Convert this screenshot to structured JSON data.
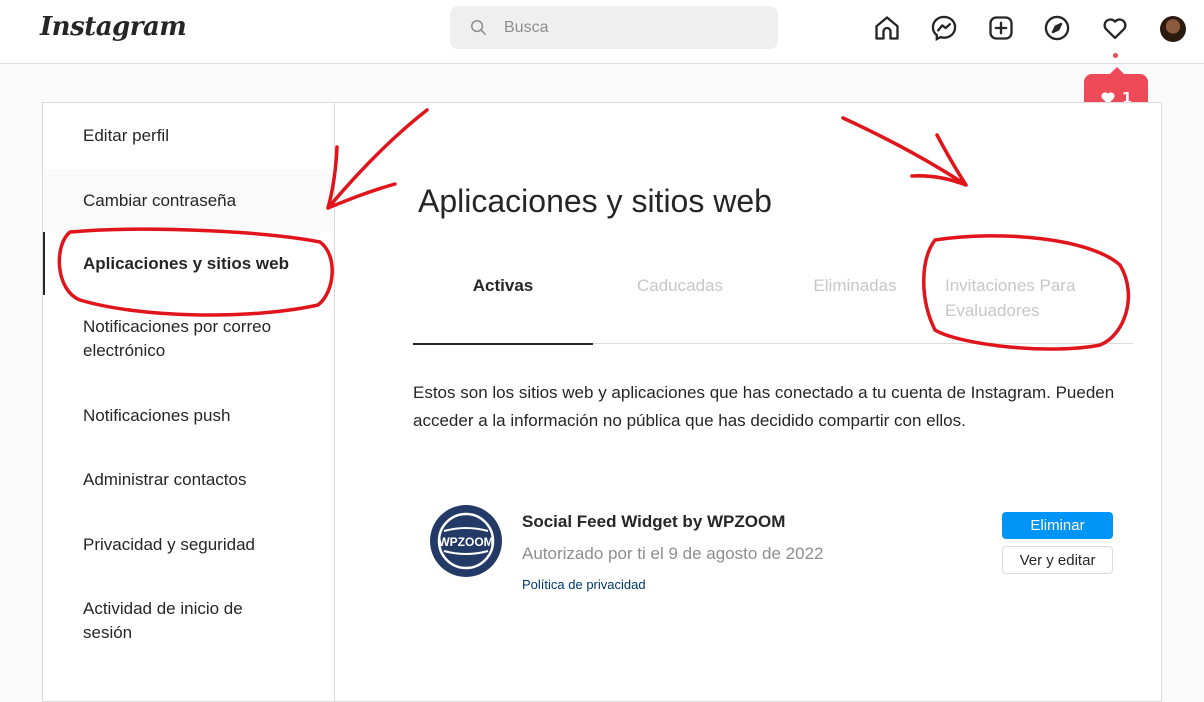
{
  "header": {
    "logo_text": "Instagram",
    "search_placeholder": "Busca",
    "notification_count": "1"
  },
  "sidebar": {
    "items": [
      {
        "label": "Editar perfil"
      },
      {
        "label": "Cambiar contraseña"
      },
      {
        "label": "Aplicaciones y sitios web"
      },
      {
        "label": "Notificaciones por correo electrónico"
      },
      {
        "label": "Notificaciones push"
      },
      {
        "label": "Administrar contactos"
      },
      {
        "label": "Privacidad y seguridad"
      },
      {
        "label": "Actividad de inicio de sesión"
      }
    ],
    "active_index": 2
  },
  "main": {
    "title": "Aplicaciones y sitios web",
    "tabs": [
      {
        "label": "Activas",
        "active": true
      },
      {
        "label": "Caducadas",
        "active": false
      },
      {
        "label": "Eliminadas",
        "active": false
      },
      {
        "label": "Invitaciones Para Evaluadores",
        "active": false
      }
    ],
    "description": "Estos son los sitios web y aplicaciones que has conectado a tu cuenta de Instagram. Pueden acceder a la información no pública que has decidido compartir con ellos.",
    "app": {
      "logo_text": "WPZOOM",
      "name": "Social Feed Widget by WPZOOM",
      "authorized": "Autorizado por ti el 9 de agosto de 2022",
      "privacy_link": "Política de privacidad",
      "remove_label": "Eliminar",
      "edit_label": "Ver y editar"
    }
  },
  "colors": {
    "accent_blue": "#0095f6",
    "notification_red": "#ed4956",
    "annotation_red": "#e0141a",
    "app_logo_bg": "#233a66"
  }
}
